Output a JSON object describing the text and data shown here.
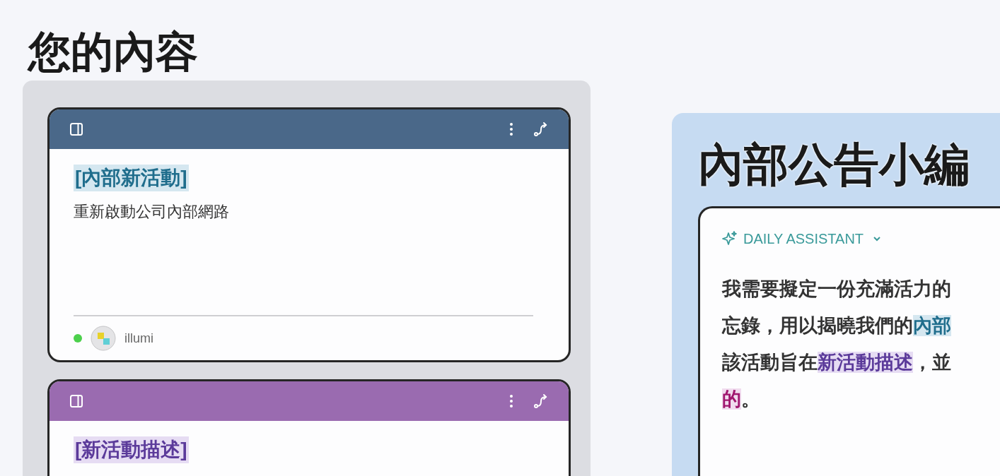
{
  "heading": "您的內容",
  "cards": [
    {
      "color": "#4a6889",
      "title": "[內部新活動]",
      "kind": "teal",
      "subtitle": "重新啟動公司內部網路",
      "author": "illumi",
      "online": true
    },
    {
      "color": "#9a6bb0",
      "title": "[新活動描述]",
      "kind": "purple"
    }
  ],
  "assistant_panel": {
    "title": "內部公告小編",
    "assistant_label": "DAILY ASSISTANT",
    "lines": [
      [
        {
          "text": "我需要擬定一份充滿活力的",
          "kind": "plain"
        }
      ],
      [
        {
          "text": "忘錄，用以揭曉我們的",
          "kind": "plain"
        },
        {
          "text": "內部",
          "kind": "teal"
        }
      ],
      [
        {
          "text": "該活動旨在",
          "kind": "plain"
        },
        {
          "text": "新活動描述",
          "kind": "purple"
        },
        {
          "text": "，並",
          "kind": "plain"
        }
      ],
      [
        {
          "text": "的",
          "kind": "pink"
        },
        {
          "text": "。",
          "kind": "plain"
        }
      ]
    ]
  }
}
